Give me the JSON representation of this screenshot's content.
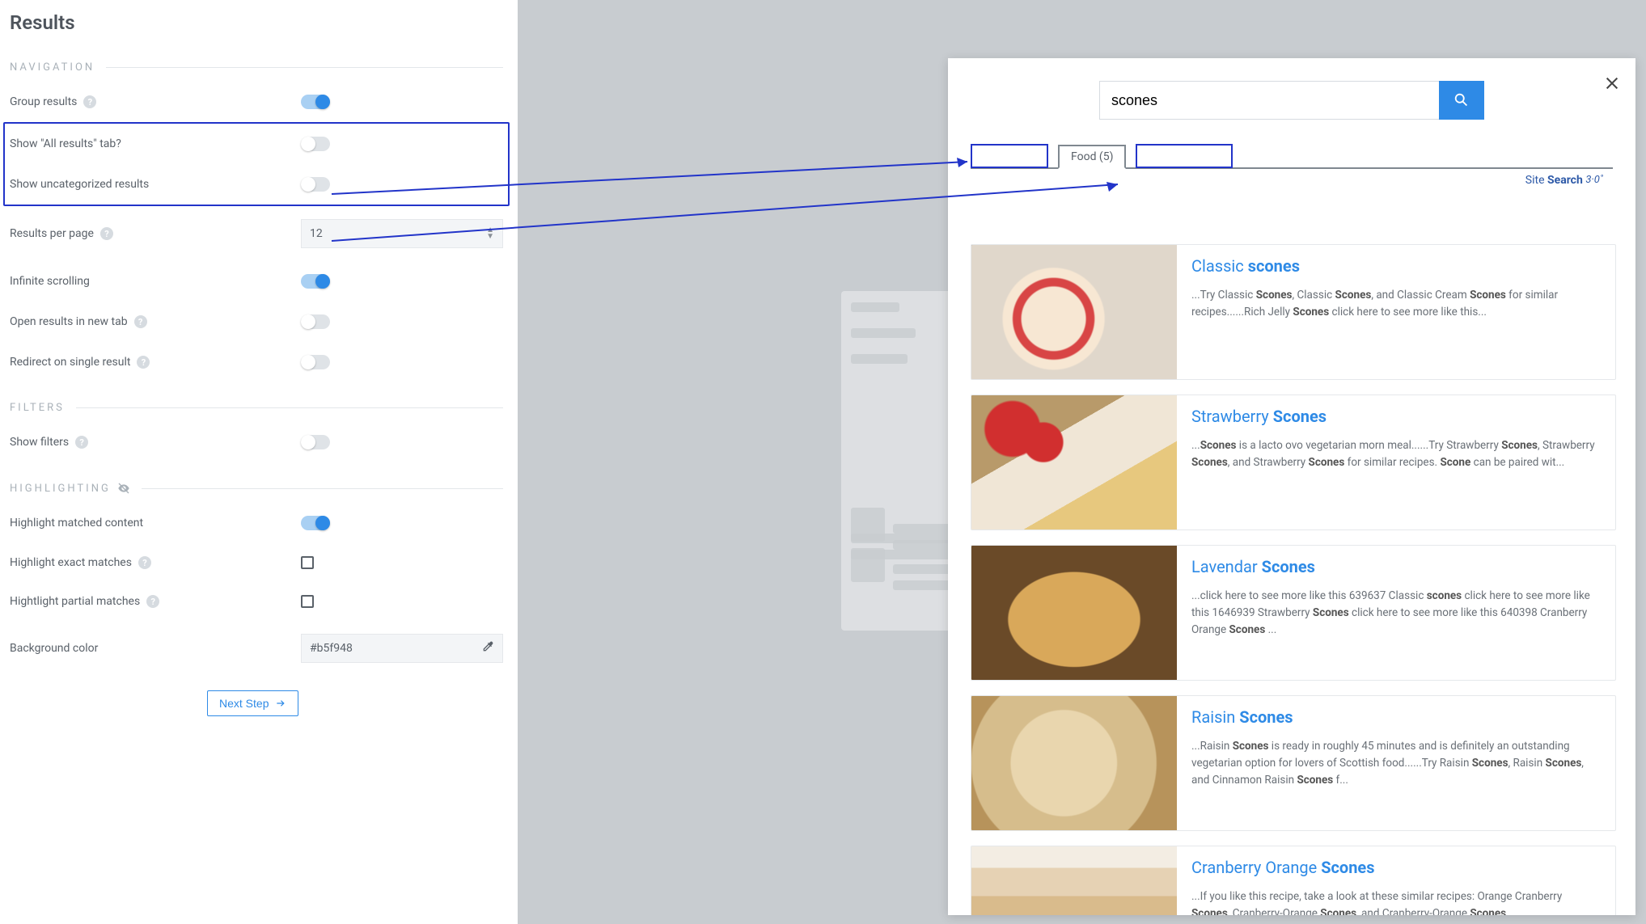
{
  "left": {
    "title": "Results",
    "sections": {
      "navigation": "NAVIGATION",
      "filters": "FILTERS",
      "highlighting": "HIGHLIGHTING"
    },
    "settings": {
      "group_results": "Group results",
      "show_all_results_tab": "Show \"All results\" tab?",
      "show_uncategorized": "Show uncategorized results",
      "results_per_page": "Results per page",
      "results_per_page_value": "12",
      "infinite_scrolling": "Infinite scrolling",
      "open_new_tab": "Open results in new tab",
      "redirect_single": "Redirect on single result",
      "show_filters": "Show filters",
      "highlight_matched": "Highlight matched content",
      "highlight_exact": "Highlight exact matches",
      "highlight_partial": "Hightlight partial matches",
      "bg_color": "Background color",
      "bg_color_value": "#b5f948"
    },
    "next_step": "Next Step"
  },
  "preview": {
    "search_value": "scones",
    "tab_food": "Food (5)",
    "brand_prefix": "Site",
    "brand_bold": "Search",
    "brand_suffix": "3·0˚",
    "results": [
      {
        "title_pre": "Classic ",
        "title_bold": "scones",
        "title_post": "",
        "snippet_html": "...Try Classic <b>Scones</b>, Classic <b>Scones</b>, and Classic Cream <b>Scones</b> for similar recipes......Rich Jelly <b>Scones</b> click here to see more like this...",
        "thumb": "th-classic"
      },
      {
        "title_pre": "Strawberry ",
        "title_bold": "Scones",
        "title_post": "",
        "snippet_html": "...<b>Scones</b> is a lacto ovo vegetarian morn meal......Try Strawberry <b>Scones</b>, Strawberry <b>Scones</b>, and Strawberry <b>Scones</b> for similar recipes. <b>Scone</b> can be paired wit...",
        "thumb": "th-straw"
      },
      {
        "title_pre": "Lavendar ",
        "title_bold": "Scones",
        "title_post": "",
        "snippet_html": "...click here to see more like this 639637 Classic <b>scones</b> click here to see more like this 1646939 Strawberry <b>Scones</b> click here to see more like this 640398 Cranberry Orange <b>Scones</b> ...",
        "thumb": "th-lav"
      },
      {
        "title_pre": "Raisin ",
        "title_bold": "Scones",
        "title_post": "",
        "snippet_html": "...Raisin <b>Scones</b> is ready in roughly 45 minutes and is definitely an outstanding vegetarian option for lovers of Scottish food......Try Raisin <b>Scones</b>, Raisin <b>Scones</b>, and Cinnamon Raisin <b>Scones</b> f...",
        "thumb": "th-raisin"
      },
      {
        "title_pre": "Cranberry Orange ",
        "title_bold": "Scones",
        "title_post": "",
        "snippet_html": "...If you like this recipe, take a look at these similar recipes: Orange Cranberry <b>Scones</b>, Cranberry-Orange <b>Scones</b>, and Cranberry-Orange <b>Scones</b>...",
        "thumb": "th-cran"
      }
    ]
  }
}
